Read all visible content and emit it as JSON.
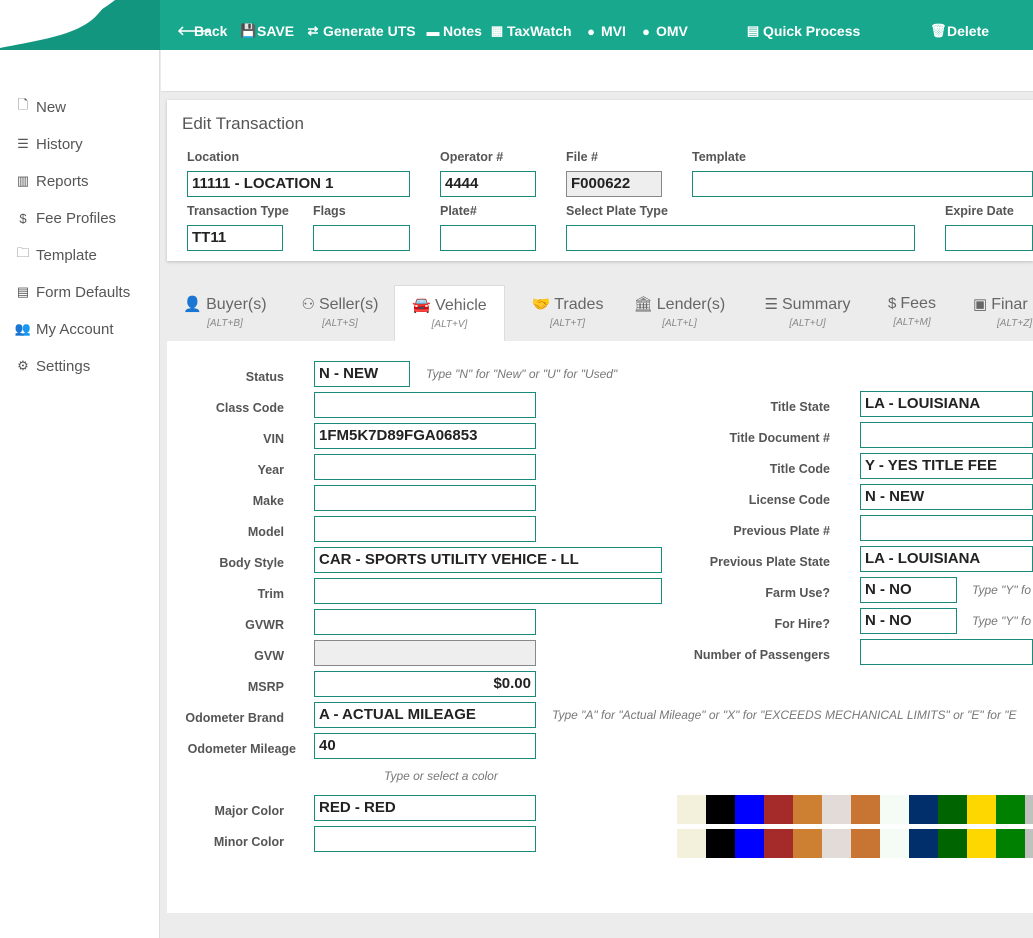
{
  "toolbar": {
    "back": "Back",
    "save": "SAVE",
    "generate_uts": "Generate UTS",
    "notes": "Notes",
    "taxwatch": "TaxWatch",
    "mvi": "MVI",
    "omv": "OMV",
    "quick_process": "Quick Process",
    "delete": "Delete"
  },
  "sidebar": {
    "items": [
      {
        "label": "New",
        "icon": "file-icon"
      },
      {
        "label": "History",
        "icon": "list-icon"
      },
      {
        "label": "Reports",
        "icon": "bar-chart-icon"
      },
      {
        "label": "Fee Profiles",
        "icon": "dollar-icon"
      },
      {
        "label": "Template",
        "icon": "folder-icon"
      },
      {
        "label": "Form Defaults",
        "icon": "form-icon"
      },
      {
        "label": "My Account",
        "icon": "users-icon"
      },
      {
        "label": "Settings",
        "icon": "gear-icon"
      }
    ]
  },
  "edit": {
    "title": "Edit Transaction",
    "location_label": "Location",
    "location_value": "11111 - LOCATION 1",
    "operator_label": "Operator #",
    "operator_value": "4444",
    "file_label": "File #",
    "file_value": "F000622",
    "template_label": "Template",
    "template_value": "",
    "trans_type_label": "Transaction Type",
    "trans_type_value": "TT11",
    "flags_label": "Flags",
    "flags_value": "",
    "plate_label": "Plate#",
    "plate_value": "",
    "plate_type_label": "Select Plate Type",
    "plate_type_value": "",
    "expire_label": "Expire Date",
    "expire_value": ""
  },
  "tabs": [
    {
      "label": "Buyer(s)",
      "shortcut": "[ALT+B]",
      "icon": "user-icon"
    },
    {
      "label": "Seller(s)",
      "shortcut": "[ALT+S]",
      "icon": "user-outline-icon"
    },
    {
      "label": "Vehicle",
      "shortcut": "[ALT+V]",
      "icon": "car-icon"
    },
    {
      "label": "Trades",
      "shortcut": "[ALT+T]",
      "icon": "handshake-icon"
    },
    {
      "label": "Lender(s)",
      "shortcut": "[ALT+L]",
      "icon": "bank-icon"
    },
    {
      "label": "Summary",
      "shortcut": "[ALT+U]",
      "icon": "list-icon"
    },
    {
      "label": "Fees",
      "shortcut": "[ALT+M]",
      "icon": "dollar-icon"
    },
    {
      "label": "Finar",
      "shortcut": "[ALT+Z]",
      "icon": "money-icon"
    }
  ],
  "vehicle": {
    "status_label": "Status",
    "status_value": "N - NEW",
    "status_hint": "Type \"N\" for \"New\" or \"U\" for \"Used\"",
    "class_label": "Class Code",
    "class_value": "",
    "vin_label": "VIN",
    "vin_value": "1FM5K7D89FGA06853",
    "year_label": "Year",
    "year_value": "",
    "make_label": "Make",
    "make_value": "",
    "model_label": "Model",
    "model_value": "",
    "body_label": "Body Style",
    "body_value": "CAR - SPORTS UTILITY VEHICE - LL",
    "trim_label": "Trim",
    "trim_value": "",
    "gvwr_label": "GVWR",
    "gvwr_value": "",
    "gvw_label": "GVW",
    "gvw_value": "",
    "msrp_label": "MSRP",
    "msrp_value": "$0.00",
    "odo_brand_label": "Odometer Brand",
    "odo_brand_value": "A - ACTUAL MILEAGE",
    "odo_brand_hint": "Type \"A\" for \"Actual Mileage\" or \"X\" for \"EXCEEDS MECHANICAL LIMITS\" or \"E\" for \"E",
    "odo_mileage_label": "Odometer Mileage",
    "odo_mileage_value": "40",
    "color_hint": "Type or select a color",
    "major_color_label": "Major Color",
    "major_color_value": "RED - RED",
    "minor_color_label": "Minor Color",
    "minor_color_value": "",
    "title_state_label": "Title State",
    "title_state_value": "LA - LOUISIANA",
    "title_doc_label": "Title Document #",
    "title_doc_value": "",
    "title_code_label": "Title Code",
    "title_code_value": "Y - YES TITLE FEE",
    "license_code_label": "License Code",
    "license_code_value": "N - NEW",
    "prev_plate_label": "Previous Plate #",
    "prev_plate_value": "",
    "prev_plate_state_label": "Previous Plate State",
    "prev_plate_state_value": "LA - LOUISIANA",
    "farm_use_label": "Farm Use?",
    "farm_use_value": "N - NO",
    "farm_use_hint": "Type \"Y\" fo",
    "for_hire_label": "For Hire?",
    "for_hire_value": "N - NO",
    "for_hire_hint": "Type \"Y\" fo",
    "passengers_label": "Number of Passengers",
    "passengers_value": ""
  },
  "color_swatches": [
    "#f3f1dc",
    "#000000",
    "#0000ff",
    "#a52a2a",
    "#cd7f32",
    "#e3dbd8",
    "#c87533",
    "#f5fbf5",
    "#002f6c",
    "#006400",
    "#ffd700",
    "#008000",
    "#c0c0c0"
  ]
}
